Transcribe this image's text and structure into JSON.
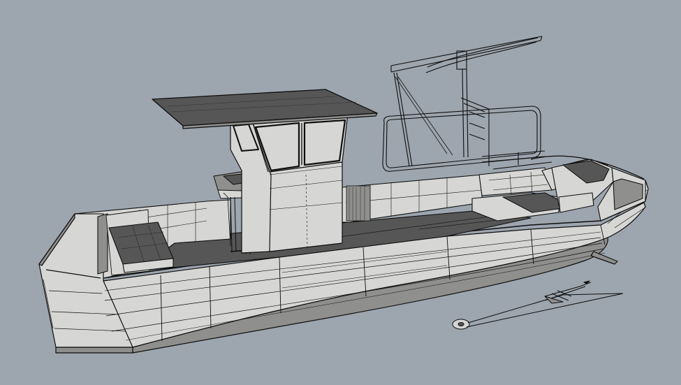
{
  "viewport": {
    "view": "perspective",
    "display_mode": "shaded-wireframe",
    "background_color": "#9da5ae",
    "line_color": "#0e0e0e",
    "surface_color": "#d6d6d4",
    "dark_surface_color": "#565656",
    "shadow_surface_color": "#8f8f8e"
  },
  "model": {
    "subject": "boat",
    "parts": [
      "hull",
      "console-cabin",
      "hardtop",
      "helm-seat",
      "deck-hatch",
      "bow-seating",
      "davit-frame",
      "anchor"
    ]
  }
}
